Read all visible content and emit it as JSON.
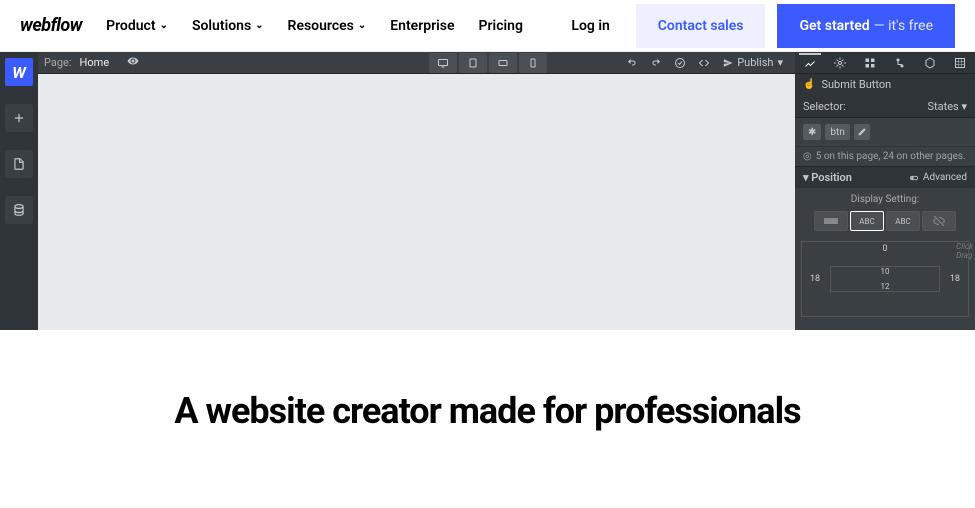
{
  "nav": {
    "logo": "webflow",
    "items": [
      "Product",
      "Solutions",
      "Resources",
      "Enterprise",
      "Pricing"
    ],
    "login": "Log in",
    "contact": "Contact sales",
    "getstarted": "Get started",
    "getstarted_suffix": "— it's free"
  },
  "designer": {
    "page_label": "Page:",
    "page_value": "Home",
    "publish": "Publish",
    "rightpanel": {
      "submit_button": "Submit Button",
      "selector_label": "Selector:",
      "states_label": "States",
      "tag_star": "✱",
      "tag_name": "btn",
      "count_text": "5 on this page, 24 on other pages.",
      "position_label": "Position",
      "advanced_label": "Advanced",
      "display_label": "Display Setting:",
      "display_btns": [
        "",
        "ABC",
        "ABC",
        ""
      ],
      "model": {
        "top": "0",
        "left": "18",
        "right": "18",
        "inner_top": "10",
        "inner_bottom": "12"
      },
      "hint_line1": "Click",
      "hint_line2": "Drag"
    }
  },
  "headline": "A website creator made for professionals"
}
